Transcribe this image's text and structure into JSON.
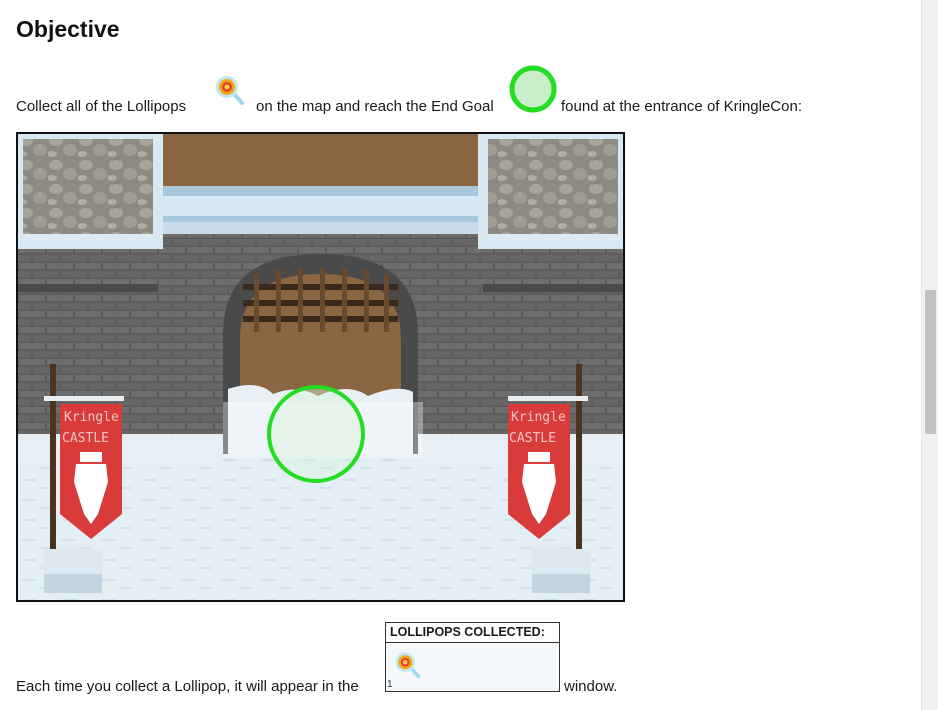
{
  "section": {
    "heading": "Objective"
  },
  "intro": {
    "text_before_lollipop": "Collect all of the Lollipops",
    "text_before_goal": "on the map and reach the End Goal",
    "text_after_goal": "found at the entrance of KringleCon:"
  },
  "map": {
    "banner_left": {
      "line1": "Kringle",
      "line2": "CASTLE"
    },
    "banner_right": {
      "line1": "Kringle",
      "line2": "CASTLE"
    }
  },
  "collected_window": {
    "header": "LOLLIPOPS COLLECTED:",
    "count": "1"
  },
  "footer_text": {
    "before_window": "Each time you collect a Lollipop, it will appear in the",
    "after_window": "window."
  },
  "icons": {
    "lollipop": "lollipop-icon",
    "goal": "end-goal-icon"
  },
  "colors": {
    "goal_ring": "#22dd22",
    "banner_red": "#d93a3a",
    "stone": "#5a5a5a",
    "snow": "#e8f1f7"
  }
}
